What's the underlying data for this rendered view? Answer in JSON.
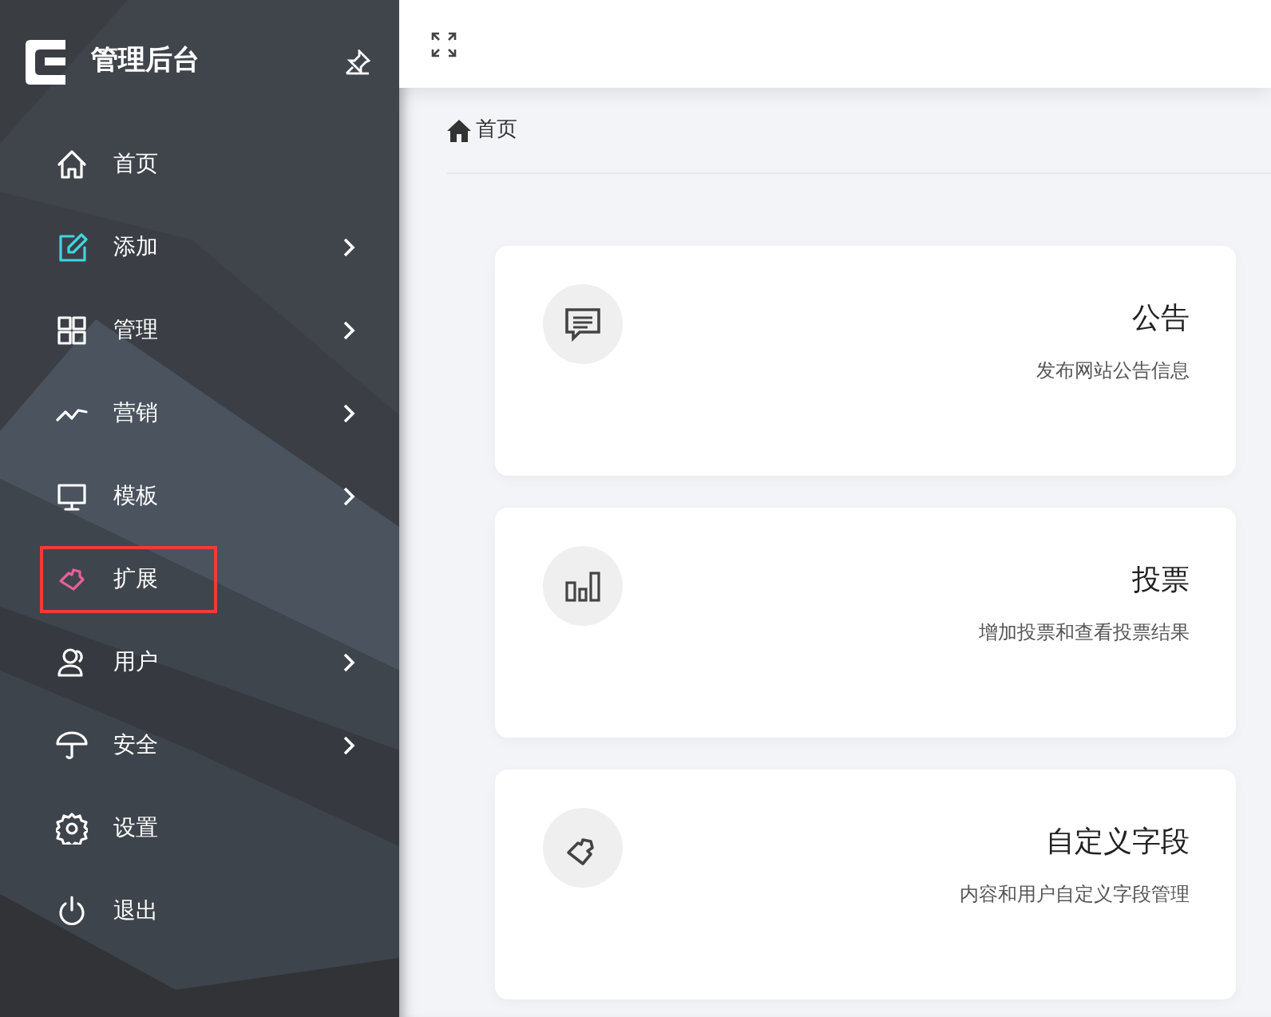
{
  "sidebar": {
    "title": "管理后台",
    "items": [
      {
        "label": "首页",
        "color": "#ffffff",
        "has_submenu": false,
        "selected": false
      },
      {
        "label": "添加",
        "color": "#3fd6e0",
        "has_submenu": true,
        "selected": false
      },
      {
        "label": "管理",
        "color": "#ffffff",
        "has_submenu": true,
        "selected": false
      },
      {
        "label": "营销",
        "color": "#ffffff",
        "has_submenu": true,
        "selected": false
      },
      {
        "label": "模板",
        "color": "#ffffff",
        "has_submenu": true,
        "selected": false
      },
      {
        "label": "扩展",
        "color": "#e8609a",
        "has_submenu": false,
        "selected": true
      },
      {
        "label": "用户",
        "color": "#ffffff",
        "has_submenu": true,
        "selected": false
      },
      {
        "label": "安全",
        "color": "#ffffff",
        "has_submenu": true,
        "selected": false
      },
      {
        "label": "设置",
        "color": "#ffffff",
        "has_submenu": false,
        "selected": false
      },
      {
        "label": "退出",
        "color": "#ffffff",
        "has_submenu": false,
        "selected": false
      }
    ]
  },
  "breadcrumb": "首页",
  "cards": [
    {
      "title": "公告",
      "description": "发布网站公告信息"
    },
    {
      "title": "投票",
      "description": "增加投票和查看投票结果"
    },
    {
      "title": "自定义字段",
      "description": "内容和用户自定义字段管理"
    }
  ]
}
